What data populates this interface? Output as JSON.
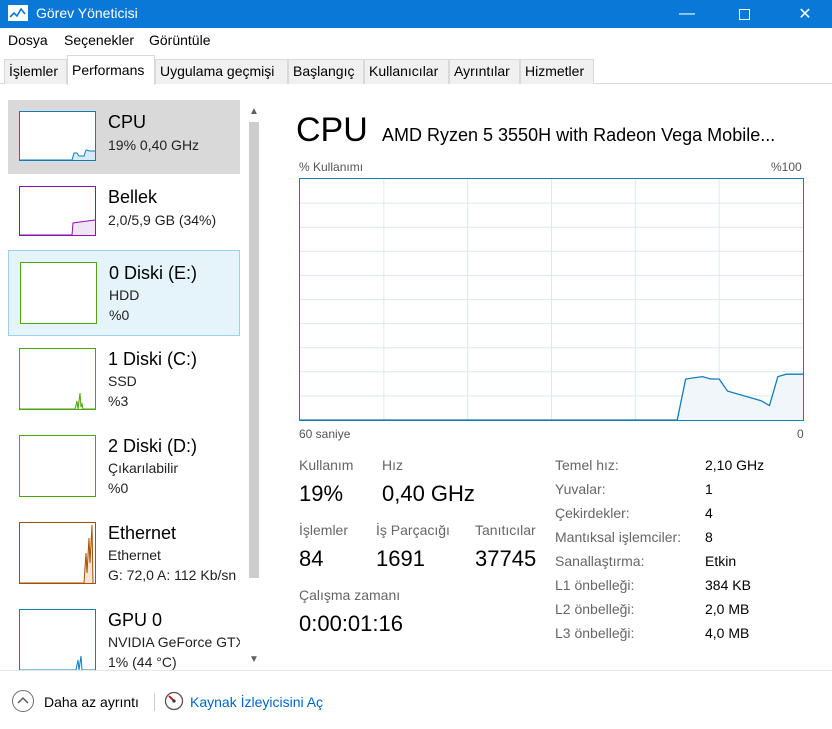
{
  "window": {
    "title": "Görev Yöneticisi"
  },
  "menu": [
    "Dosya",
    "Seçenekler",
    "Görüntüle"
  ],
  "tabs": [
    "İşlemler",
    "Performans",
    "Uygulama geçmişi",
    "Başlangıç",
    "Kullanıcılar",
    "Ayrıntılar",
    "Hizmetler"
  ],
  "active_tab": "Performans",
  "sidebar": {
    "items": [
      {
        "name": "CPU",
        "line1": "19%  0,40 GHz",
        "line2": "",
        "color": "#117dbb"
      },
      {
        "name": "Bellek",
        "line1": "2,0/5,9 GB (34%)",
        "line2": "",
        "color": "#8b12ae"
      },
      {
        "name": "0 Diski (E:)",
        "line1": "HDD",
        "line2": "%0",
        "color": "#4da60c"
      },
      {
        "name": "1 Diski (C:)",
        "line1": "SSD",
        "line2": "%3",
        "color": "#4da60c"
      },
      {
        "name": "2 Diski (D:)",
        "line1": "Çıkarılabilir",
        "line2": "%0",
        "color": "#4da60c"
      },
      {
        "name": "Ethernet",
        "line1": "Ethernet",
        "line2": "G: 72,0  A: 112 Kb/sn",
        "color": "#a74f01"
      },
      {
        "name": "GPU 0",
        "line1": "NVIDIA GeForce GTX",
        "line2": "1%  (44 °C)",
        "color": "#117dbb"
      }
    ]
  },
  "main": {
    "title": "CPU",
    "model": "AMD Ryzen 5 3550H with Radeon Vega Mobile...",
    "graph_top_left": "% Kullanımı",
    "graph_top_right": "%100",
    "graph_bottom_left": "60 saniye",
    "graph_bottom_right": "0",
    "stats": {
      "usage_label": "Kullanım",
      "usage_value": "19%",
      "speed_label": "Hız",
      "speed_value": "0,40 GHz",
      "processes_label": "İşlemler",
      "processes_value": "84",
      "threads_label": "İş Parçacığı",
      "threads_value": "1691",
      "handles_label": "Tanıtıcılar",
      "handles_value": "37745",
      "uptime_label": "Çalışma zamanı",
      "uptime_value": "0:00:01:16"
    },
    "details": [
      {
        "label": "Temel hız:",
        "value": "2,10 GHz"
      },
      {
        "label": "Yuvalar:",
        "value": "1"
      },
      {
        "label": "Çekirdekler:",
        "value": "4"
      },
      {
        "label": "Mantıksal işlemciler:",
        "value": "8"
      },
      {
        "label": "Sanallaştırma:",
        "value": "Etkin"
      },
      {
        "label": "L1 önbelleği:",
        "value": "384 KB"
      },
      {
        "label": "L2 önbelleği:",
        "value": "2,0 MB"
      },
      {
        "label": "L3 önbelleği:",
        "value": "4,0 MB"
      }
    ]
  },
  "chart_data": {
    "type": "area",
    "ylim": [
      0,
      100
    ],
    "xlim": [
      60,
      0
    ],
    "x": [
      60,
      15,
      14,
      12,
      11,
      10,
      9,
      5,
      4,
      3,
      2,
      0
    ],
    "values": [
      0,
      0,
      17,
      18,
      17,
      17,
      12,
      8,
      6,
      18,
      19,
      19
    ]
  },
  "bottom": {
    "fewer_details": "Daha az ayrıntı",
    "resource_monitor": "Kaynak İzleyicisini Aç"
  },
  "colors": {
    "titlebar": "#0a78d7",
    "accent": "#117dbb",
    "link": "#0066cc"
  }
}
